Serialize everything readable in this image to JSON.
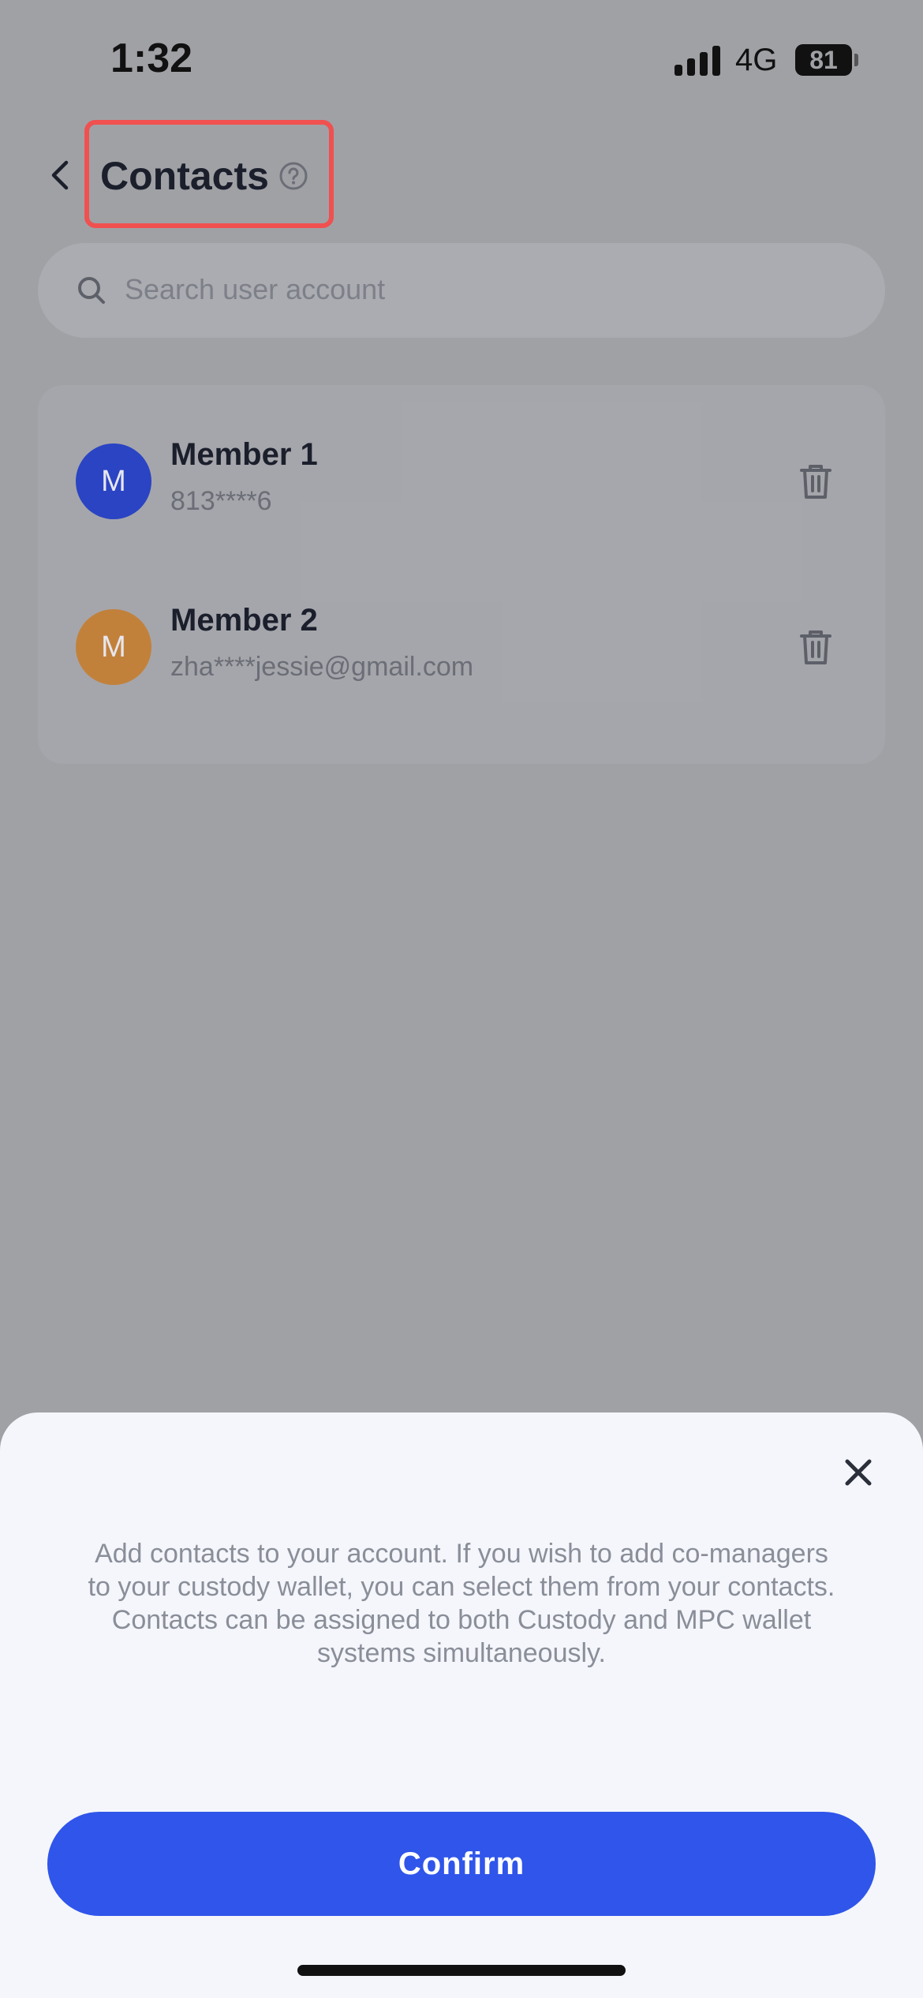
{
  "status": {
    "time": "1:32",
    "network": "4G",
    "battery": "81"
  },
  "header": {
    "title": "Contacts"
  },
  "search": {
    "placeholder": "Search user account"
  },
  "contacts": [
    {
      "initial": "M",
      "name": "Member 1",
      "account": "813****6",
      "color": "#2a44c3"
    },
    {
      "initial": "M",
      "name": "Member 2",
      "account": "zha****jessie@gmail.com",
      "color": "#c2813b"
    }
  ],
  "sheet": {
    "description": "Add contacts to your account. If you wish to add co-managers to your custody wallet, you can select them from your contacts. Contacts can be assigned to both Custody and MPC wallet systems simultaneously.",
    "confirm_label": "Confirm"
  },
  "colors": {
    "accent": "#2f55ea",
    "highlight": "#f05050"
  }
}
